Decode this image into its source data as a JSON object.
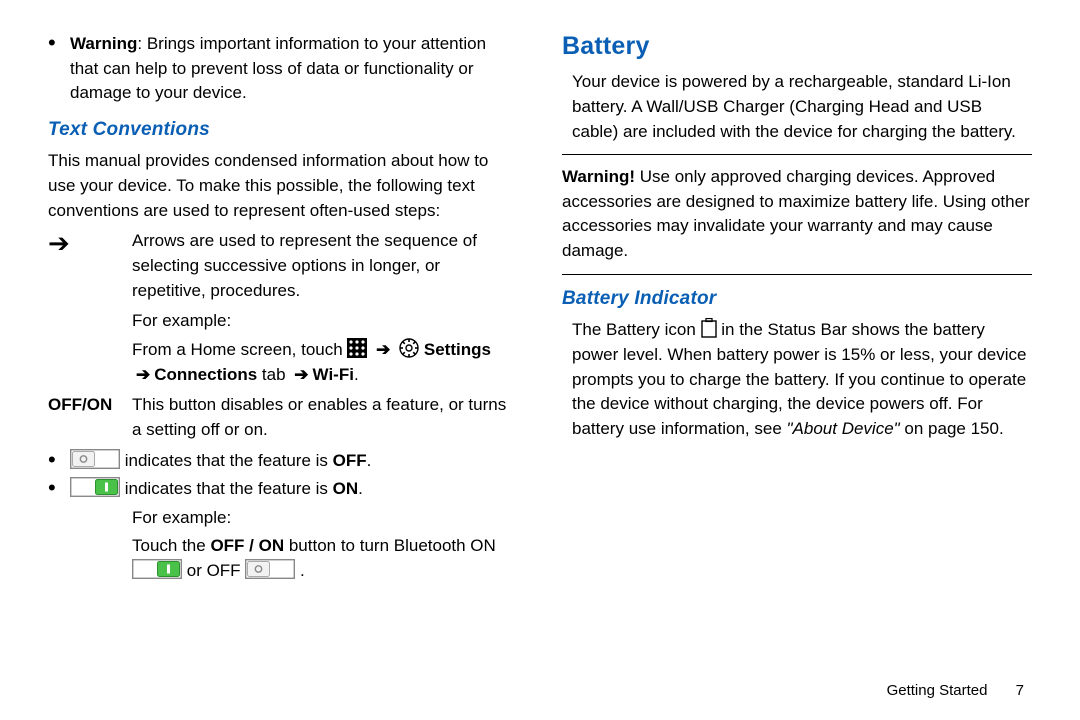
{
  "left": {
    "warning_bullet": {
      "label": "Warning",
      "text": ": Brings important information to your attention that can help to prevent loss of data or functionality or damage to your device."
    },
    "text_conventions_h": "Text Conventions",
    "intro": "This manual provides condensed information about how to use your device. To make this possible, the following text conventions are used to represent often-used steps:",
    "arrow_def": "Arrows are used to represent the sequence of selecting successive options in longer, or repetitive, procedures.",
    "for_example": "For example:",
    "example_prefix": "From a Home screen, touch ",
    "settings": "Settings",
    "connections_tab": "Connections",
    "tab_word": " tab ",
    "wifi": "Wi-Fi",
    "offon_term": "OFF/ON",
    "offon_def": "This button disables or enables a feature, or turns a setting off or on.",
    "ind_off_pre": " indicates that the feature is ",
    "off": "OFF",
    "on": "ON",
    "bt_line_a": "Touch the ",
    "bt_line_b": "OFF / ON",
    "bt_line_c": " button to turn Bluetooth ON ",
    "or_off": " or OFF "
  },
  "right": {
    "battery_h": "Battery",
    "battery_p": "Your device is powered by a rechargeable, standard Li-Ion battery. A Wall/USB Charger (Charging Head and USB cable) are included with the device for charging the battery.",
    "warn_label": "Warning!",
    "warn_text": "Use only approved charging devices. Approved accessories are designed to maximize battery life. Using other accessories may invalidate your warranty and may cause damage.",
    "indicator_h": "Battery Indicator",
    "indicator_p_a": "The Battery icon ",
    "indicator_p_b": " in the Status Bar shows the battery power level. When battery power is 15% or less, your device prompts you to charge the battery. If you continue to operate the device without charging, the device powers off. For battery use information, see ",
    "about_device": "\"About Device\"",
    "page_ref": " on page 150."
  },
  "footer": {
    "section": "Getting Started",
    "page": "7"
  }
}
